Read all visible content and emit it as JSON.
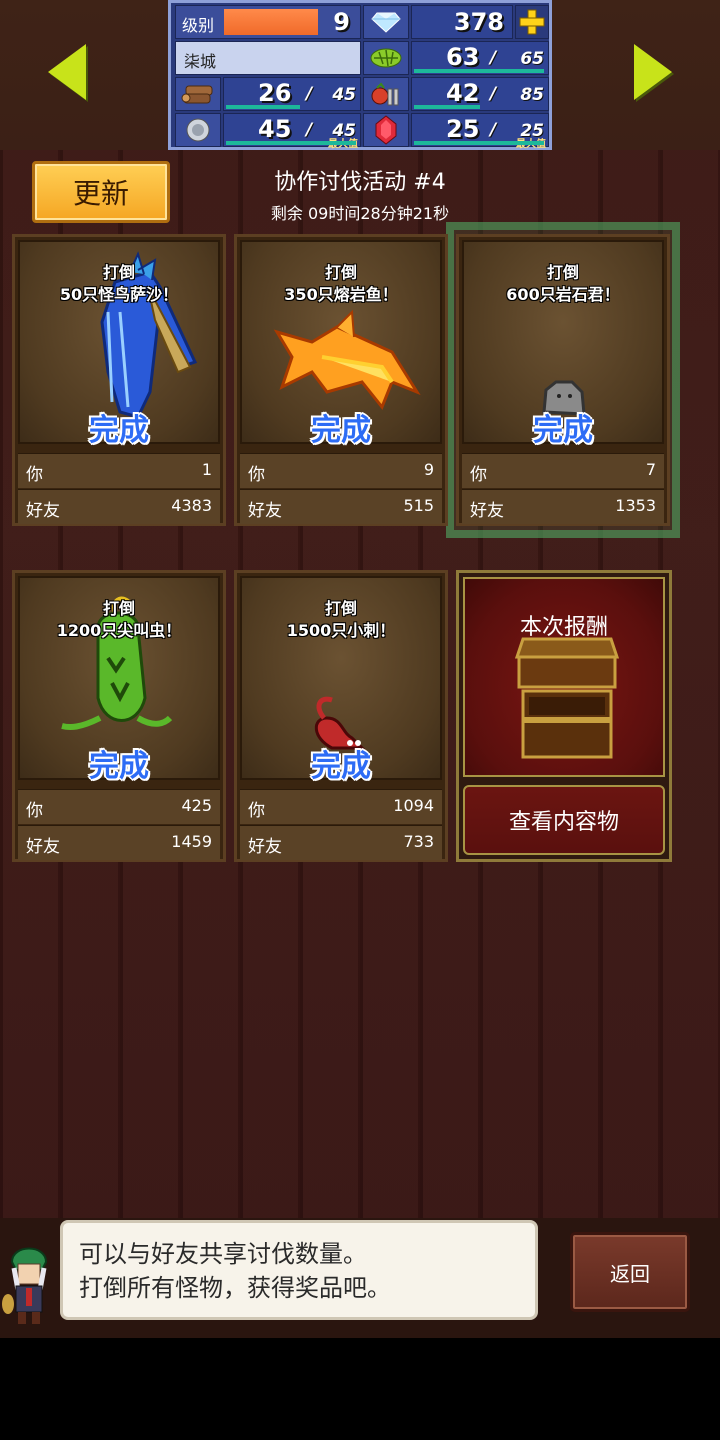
{
  "stats": {
    "level_label": "级别",
    "level_value": "9",
    "gems": "378",
    "town_name": "柒城",
    "grass_current": "63",
    "grass_max": "65",
    "wood_current": "26",
    "wood_max": "45",
    "food_current": "42",
    "food_max": "85",
    "ore_current": "45",
    "ore_max": "45",
    "ore_note": "最大值",
    "ruby_current": "25",
    "ruby_max": "25",
    "ruby_note": "最大值",
    "slash": "/"
  },
  "header": {
    "refresh_label": "更新",
    "event_title": "协作讨伐活动 #4",
    "remaining": "剩余 09时间28分钟21秒"
  },
  "labels": {
    "you": "你",
    "friends": "好友",
    "complete": "完成"
  },
  "cards": [
    {
      "line1": "打倒",
      "line2": "50只怪鸟萨沙！",
      "you": "1",
      "friends": "4383"
    },
    {
      "line1": "打倒",
      "line2": "350只熔岩鱼！",
      "you": "9",
      "friends": "515"
    },
    {
      "line1": "打倒",
      "line2": "600只岩石君！",
      "you": "7",
      "friends": "1353"
    },
    {
      "line1": "打倒",
      "line2": "1200只尖叫虫！",
      "you": "425",
      "friends": "1459"
    },
    {
      "line1": "打倒",
      "line2": "1500只小刺！",
      "you": "1094",
      "friends": "733"
    }
  ],
  "reward": {
    "title": "本次报酬",
    "view_label": "查看内容物"
  },
  "dialog": {
    "line1": "可以与好友共享讨伐数量。",
    "line2": "打倒所有怪物，获得奖品吧。"
  },
  "back_label": "返回",
  "colors": {
    "accent_orange": "#f5a623",
    "arrow_green": "#c8e31a",
    "complete_blue": "#2d6cf5",
    "highlight_green": "#50aa64"
  }
}
